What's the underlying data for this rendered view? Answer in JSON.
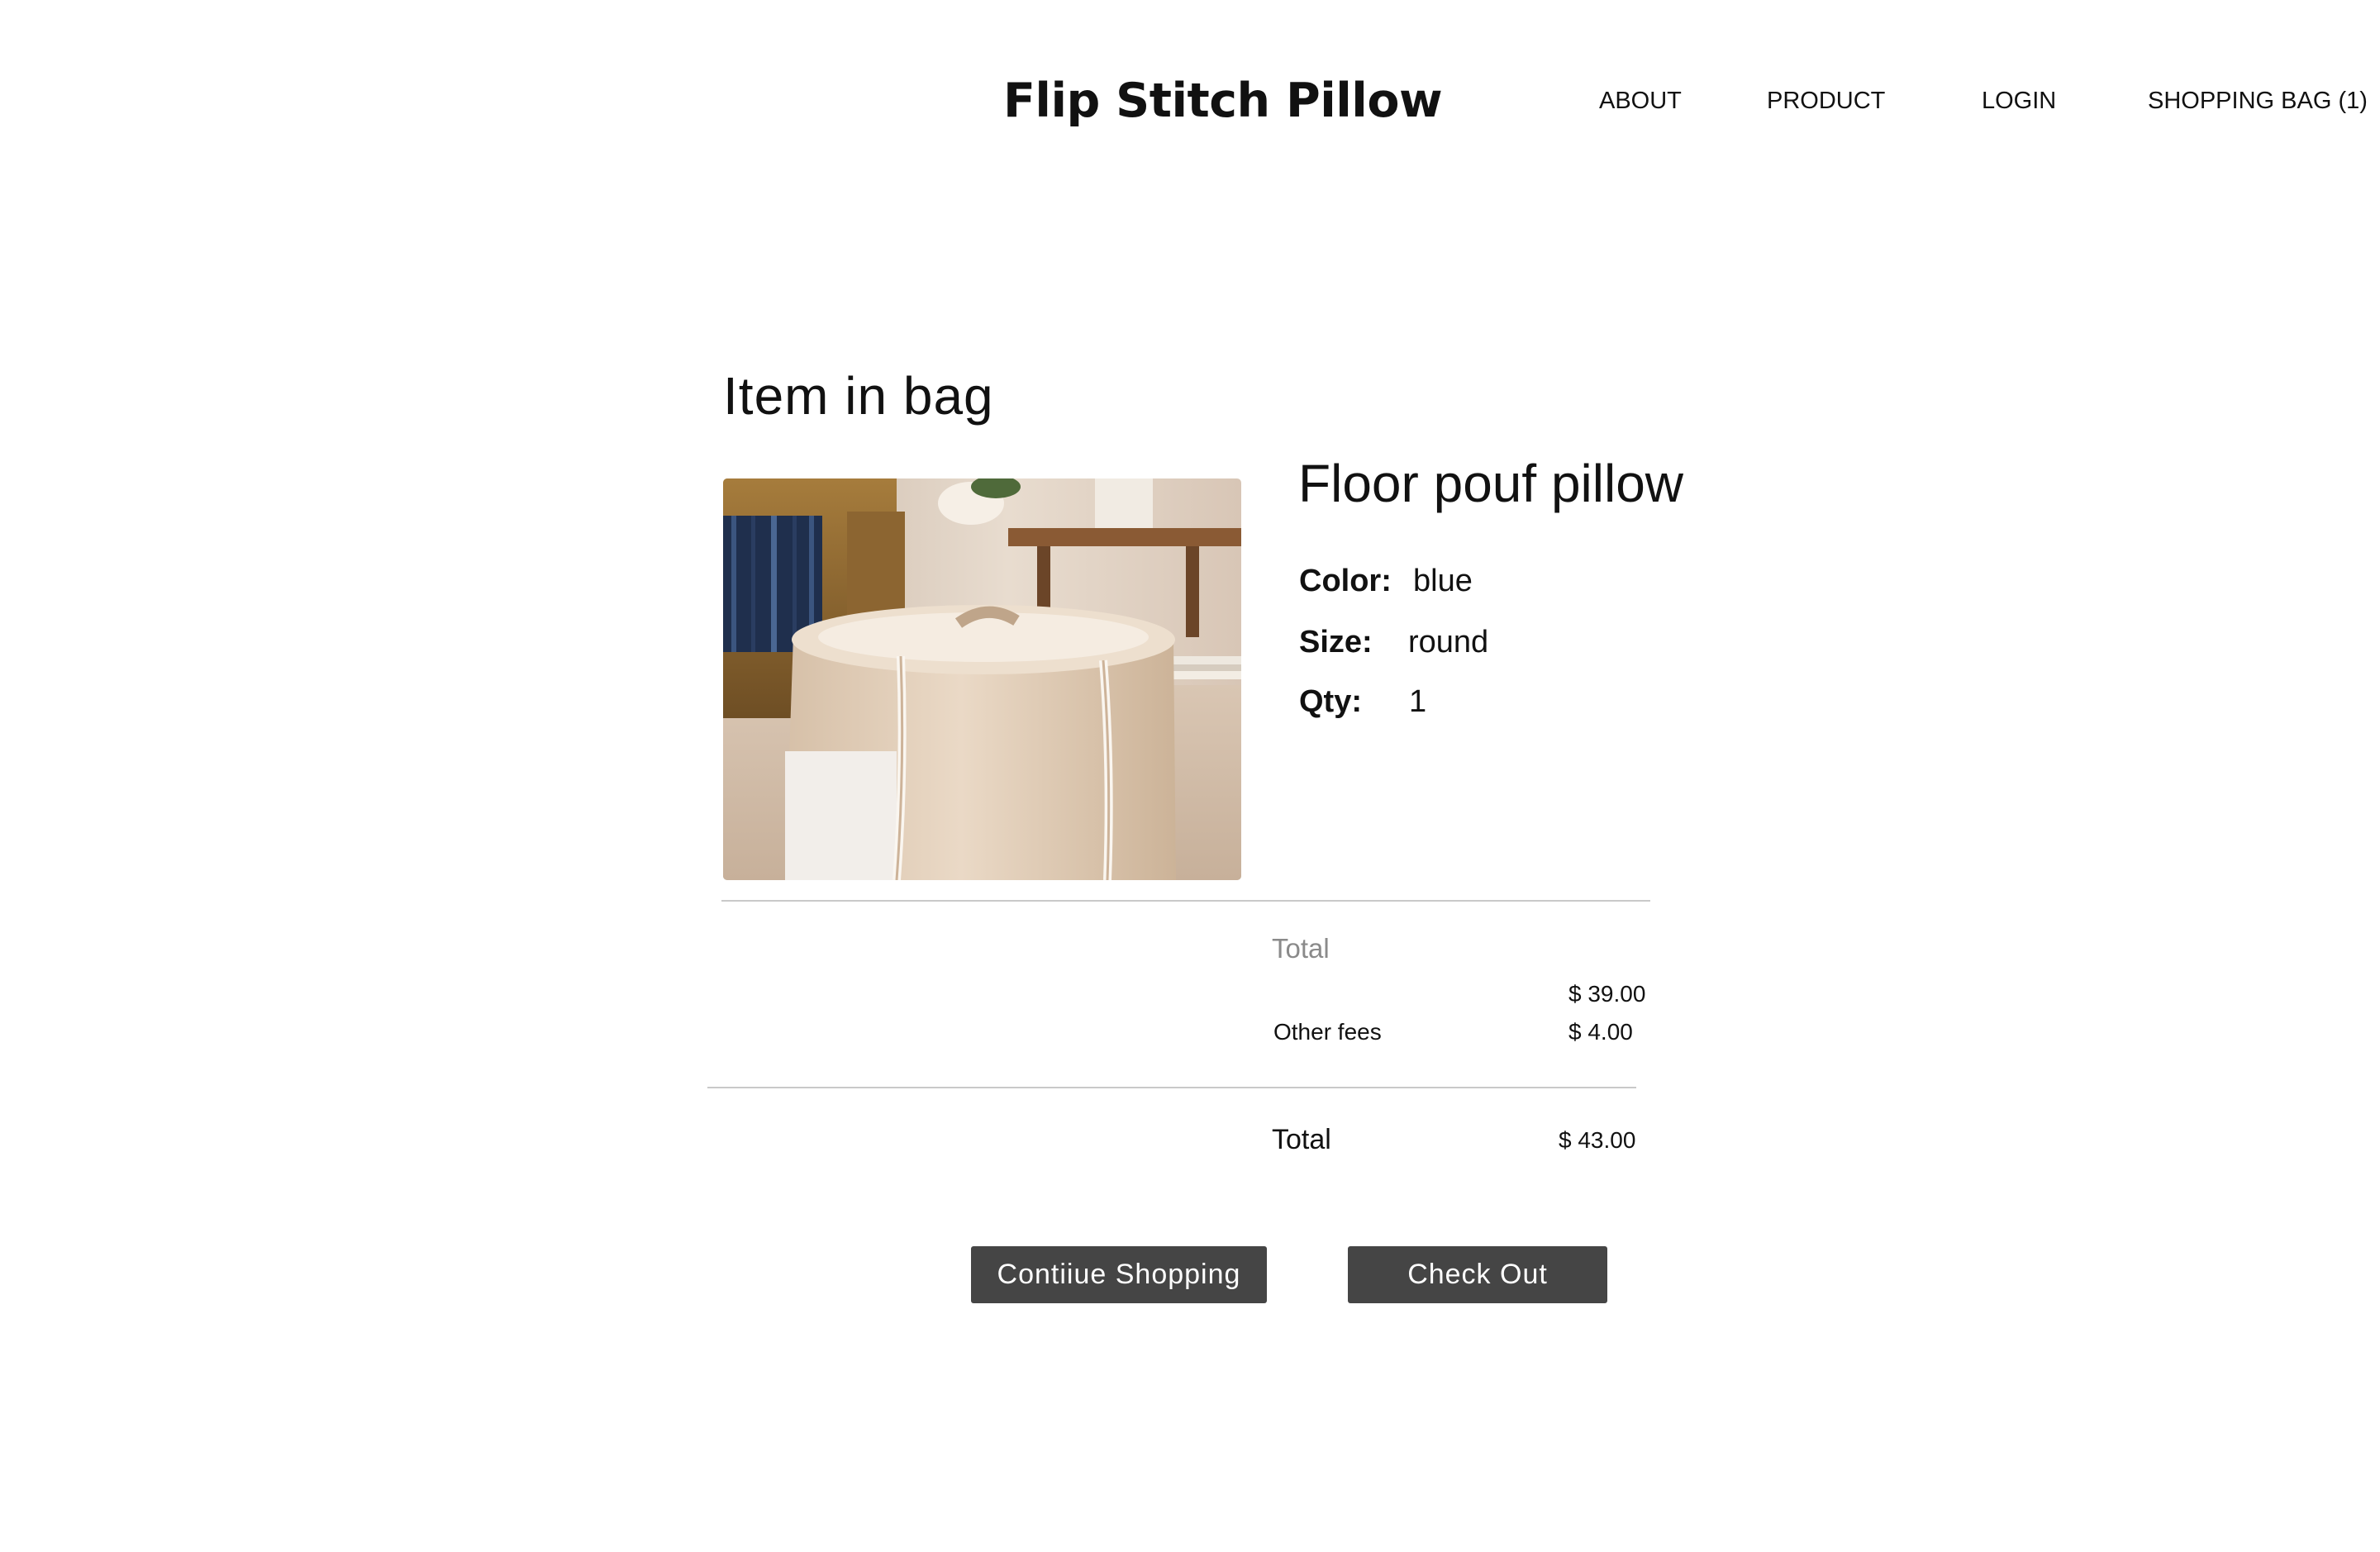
{
  "header": {
    "brand": "Flip Stitch Pillow",
    "nav": {
      "about": "ABOUT",
      "product": "PRODUCT",
      "login": "LOGIN",
      "bag": "SHOPPING BAG (1)"
    }
  },
  "bag": {
    "heading": "Item in bag",
    "item": {
      "name": "Floor pouf pillow",
      "color_label": "Color:",
      "color_value": "blue",
      "size_label": "Size:",
      "size_value": "round",
      "qty_label": "Qty:",
      "qty_value": "1"
    }
  },
  "summary": {
    "total_label": "Total",
    "subtotal_value": "$ 39.00",
    "fees_label": "Other fees",
    "fees_value": "$ 4.00",
    "grand_total_label": "Total",
    "grand_total_value": "$ 43.00"
  },
  "actions": {
    "continue_label": "Contiiue Shopping",
    "checkout_label": "Check Out"
  },
  "colors": {
    "button_bg": "#454545",
    "button_text": "#ffffff",
    "divider": "#c9c9c9",
    "muted_text": "#8a8a8a"
  }
}
